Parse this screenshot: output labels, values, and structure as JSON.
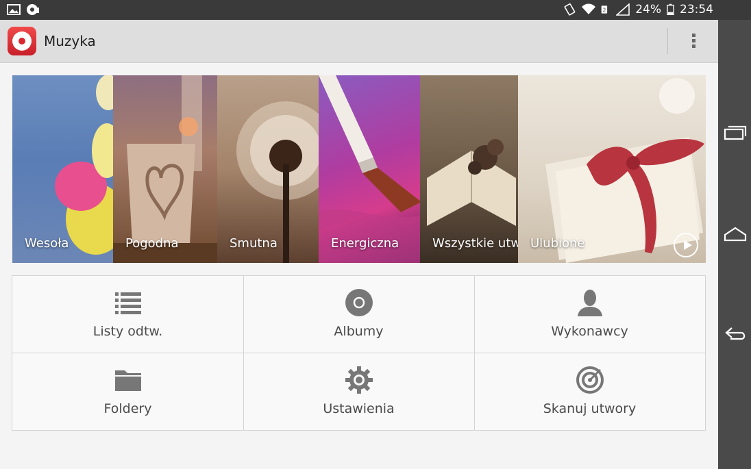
{
  "status_bar": {
    "battery": "24%",
    "time": "23:54",
    "left_icons": [
      "image-notification-icon",
      "music-notification-icon"
    ],
    "right_icons": [
      "rotation-lock-icon",
      "wifi-icon",
      "sim-icon",
      "signal-icon",
      "battery-icon"
    ]
  },
  "app": {
    "title": "Muzyka",
    "accent": "#d9282f"
  },
  "banner": {
    "tiles": [
      {
        "label": "Wesoła"
      },
      {
        "label": "Pogodna"
      },
      {
        "label": "Smutna"
      },
      {
        "label": "Energiczna"
      },
      {
        "label": "Wszystkie utw"
      },
      {
        "label": "Ulubione"
      }
    ]
  },
  "menu": {
    "items": [
      {
        "label": "Listy odtw.",
        "icon": "playlist-icon"
      },
      {
        "label": "Albumy",
        "icon": "album-disc-icon"
      },
      {
        "label": "Wykonawcy",
        "icon": "artist-person-icon"
      },
      {
        "label": "Foldery",
        "icon": "folder-icon"
      },
      {
        "label": "Ustawienia",
        "icon": "gear-icon"
      },
      {
        "label": "Skanuj utwory",
        "icon": "scan-target-icon"
      }
    ]
  },
  "nav_bar": {
    "buttons": [
      "recent-apps-icon",
      "home-icon",
      "back-icon"
    ]
  }
}
